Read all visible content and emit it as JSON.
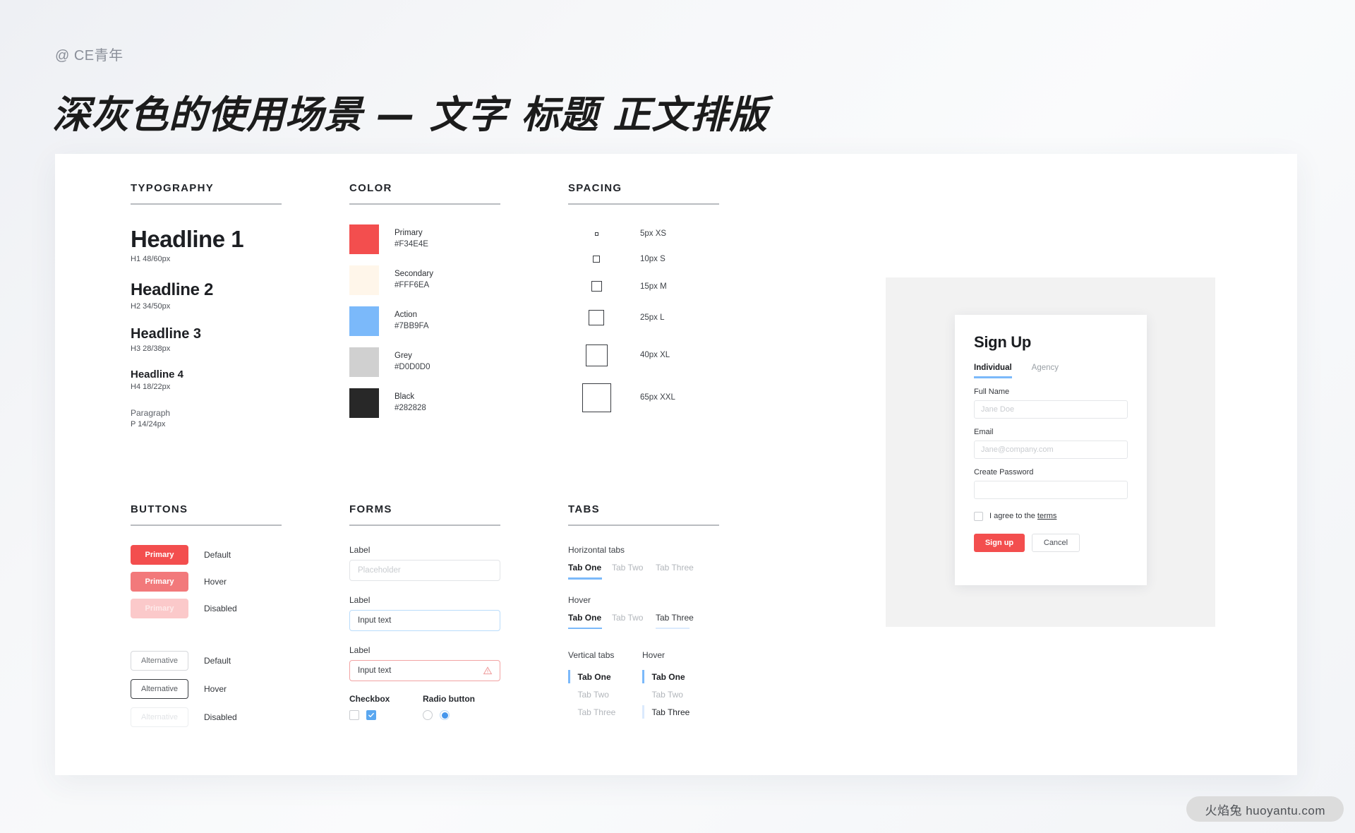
{
  "header": {
    "handle": "@ CE青年",
    "title": "深灰色的使用场景 — 文字 标题 正文排版"
  },
  "typography": {
    "section_title": "TYPOGRAPHY",
    "items": [
      {
        "sample": "Headline 1",
        "meta": "H1 48/60px"
      },
      {
        "sample": "Headline 2",
        "meta": "H2 34/50px"
      },
      {
        "sample": "Headline 3",
        "meta": "H3 28/38px"
      },
      {
        "sample": "Headline 4",
        "meta": "H4 18/22px"
      },
      {
        "sample": "Paragraph",
        "meta": "P 14/24px"
      }
    ]
  },
  "color": {
    "section_title": "COLOR",
    "items": [
      {
        "name": "Primary",
        "hex": "#F34E4E"
      },
      {
        "name": "Secondary",
        "hex": "#FFF6EA"
      },
      {
        "name": "Action",
        "hex": "#7BB9FA"
      },
      {
        "name": "Grey",
        "hex": "#D0D0D0"
      },
      {
        "name": "Black",
        "hex": "#282828"
      }
    ]
  },
  "spacing": {
    "section_title": "SPACING",
    "items": [
      {
        "label": "5px XS",
        "size": 5
      },
      {
        "label": "10px S",
        "size": 10
      },
      {
        "label": "15px M",
        "size": 15
      },
      {
        "label": "25px L",
        "size": 22
      },
      {
        "label": "40px XL",
        "size": 31
      },
      {
        "label": "65px XXL",
        "size": 41
      }
    ]
  },
  "buttons": {
    "section_title": "BUTTONS",
    "primary": [
      {
        "label": "Primary",
        "state": "Default"
      },
      {
        "label": "Primary",
        "state": "Hover"
      },
      {
        "label": "Primary",
        "state": "Disabled"
      }
    ],
    "alternative": [
      {
        "label": "Alternative",
        "state": "Default"
      },
      {
        "label": "Alternative",
        "state": "Hover"
      },
      {
        "label": "Alternative",
        "state": "Disabled"
      }
    ]
  },
  "forms": {
    "section_title": "FORMS",
    "fields": [
      {
        "label": "Label",
        "value": "Placeholder",
        "state": "placeholder"
      },
      {
        "label": "Label",
        "value": "Input text",
        "state": "focus"
      },
      {
        "label": "Label",
        "value": "Input text",
        "state": "error"
      }
    ],
    "checkbox_heading": "Checkbox",
    "radio_heading": "Radio button"
  },
  "tabs": {
    "section_title": "TABS",
    "horizontal_heading": "Horizontal tabs",
    "hover_heading": "Hover",
    "horizontal": [
      "Tab One",
      "Tab Two",
      "Tab Three"
    ],
    "horizontal_hover": [
      "Tab One",
      "Tab Two",
      "Tab Three"
    ],
    "vertical_heading": "Vertical tabs",
    "vertical_hover_heading": "Hover",
    "vertical": [
      "Tab One",
      "Tab Two",
      "Tab Three"
    ],
    "vertical_hover": [
      "Tab One",
      "Tab Two",
      "Tab Three"
    ]
  },
  "signup": {
    "title": "Sign Up",
    "tabs": [
      "Individual",
      "Agency"
    ],
    "fields": [
      {
        "label": "Full Name",
        "placeholder": "Jane Doe"
      },
      {
        "label": "Email",
        "placeholder": "Jane@company.com"
      },
      {
        "label": "Create Password",
        "placeholder": ""
      }
    ],
    "agree_prefix": "I agree to the ",
    "agree_link": "terms",
    "submit_label": "Sign up",
    "cancel_label": "Cancel"
  },
  "watermark": {
    "text": "火焰兔 huoyantu.com"
  }
}
